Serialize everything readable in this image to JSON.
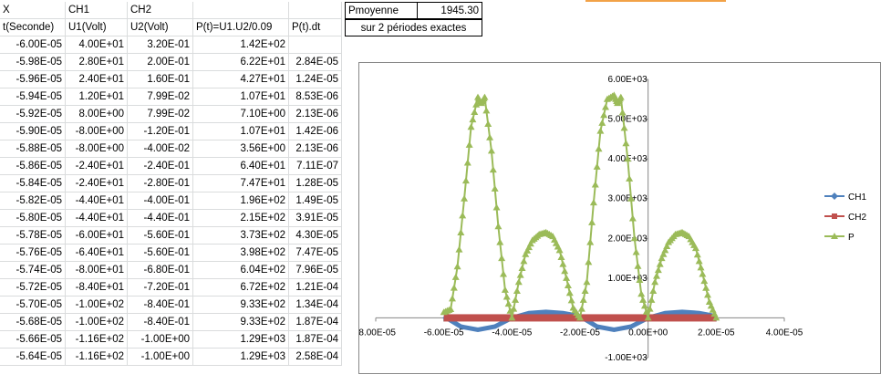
{
  "header": {
    "x": "X",
    "ch1": "CH1",
    "ch2": "CH2"
  },
  "columns": {
    "t": "t(Seconde)",
    "u1": "U1(Volt)",
    "u2": "U2(Volt)",
    "p": "P(t)=U1.U2/0.09",
    "pdt": "P(t).dt"
  },
  "rows": [
    [
      "-6.00E-05",
      "4.00E+01",
      "3.20E-01",
      "1.42E+02",
      ""
    ],
    [
      "-5.98E-05",
      "2.80E+01",
      "2.00E-01",
      "6.22E+01",
      "2.84E-05"
    ],
    [
      "-5.96E-05",
      "2.40E+01",
      "1.60E-01",
      "4.27E+01",
      "1.24E-05"
    ],
    [
      "-5.94E-05",
      "1.20E+01",
      "7.99E-02",
      "1.07E+01",
      "8.53E-06"
    ],
    [
      "-5.92E-05",
      "8.00E+00",
      "7.99E-02",
      "7.10E+00",
      "2.13E-06"
    ],
    [
      "-5.90E-05",
      "-8.00E+00",
      "-1.20E-01",
      "1.07E+01",
      "1.42E-06"
    ],
    [
      "-5.88E-05",
      "-8.00E+00",
      "-4.00E-02",
      "3.56E+00",
      "2.13E-06"
    ],
    [
      "-5.86E-05",
      "-2.40E+01",
      "-2.40E-01",
      "6.40E+01",
      "7.11E-07"
    ],
    [
      "-5.84E-05",
      "-2.40E+01",
      "-2.80E-01",
      "7.47E+01",
      "1.28E-05"
    ],
    [
      "-5.82E-05",
      "-4.40E+01",
      "-4.00E-01",
      "1.96E+02",
      "1.49E-05"
    ],
    [
      "-5.80E-05",
      "-4.40E+01",
      "-4.40E-01",
      "2.15E+02",
      "3.91E-05"
    ],
    [
      "-5.78E-05",
      "-6.00E+01",
      "-5.60E-01",
      "3.73E+02",
      "4.30E-05"
    ],
    [
      "-5.76E-05",
      "-6.40E+01",
      "-5.60E-01",
      "3.98E+02",
      "7.47E-05"
    ],
    [
      "-5.74E-05",
      "-8.00E+01",
      "-6.80E-01",
      "6.04E+02",
      "7.96E-05"
    ],
    [
      "-5.72E-05",
      "-8.40E+01",
      "-7.20E-01",
      "6.72E+02",
      "1.21E-04"
    ],
    [
      "-5.70E-05",
      "-1.00E+02",
      "-8.40E-01",
      "9.33E+02",
      "1.34E-04"
    ],
    [
      "-5.68E-05",
      "-1.00E+02",
      "-8.40E-01",
      "9.33E+02",
      "1.87E-04"
    ],
    [
      "-5.66E-05",
      "-1.16E+02",
      "-1.00E+00",
      "1.29E+03",
      "1.87E-04"
    ],
    [
      "-5.64E-05",
      "-1.16E+02",
      "-1.00E+00",
      "1.29E+03",
      "2.58E-04"
    ]
  ],
  "summary": {
    "label": "Pmoyenne",
    "value": "1945.30",
    "note": "sur 2 périodes exactes"
  },
  "chart_data": {
    "type": "line",
    "title": "",
    "xlim": [
      -8e-05,
      4e-05
    ],
    "ylim": [
      -1000,
      6000
    ],
    "x_ticks": [
      "-8.00E-05",
      "-6.00E-05",
      "-4.00E-05",
      "-2.00E-05",
      "0.00E+00",
      "2.00E-05",
      "4.00E-05"
    ],
    "y_ticks": [
      "-1.00E+03",
      "0.00E+00",
      "1.00E+03",
      "2.00E+03",
      "3.00E+03",
      "4.00E+03",
      "5.00E+03",
      "6.00E+03"
    ],
    "legend_position": "right",
    "series": [
      {
        "name": "CH1",
        "color": "#4f81bd",
        "marker": "diamond",
        "description": "sinusoid, range about -300 to 150, period 4.00E-05",
        "x": [
          -6e-05,
          -5.5e-05,
          -5e-05,
          -4.5e-05,
          -4e-05,
          -3.5e-05,
          -3e-05,
          -2.5e-05,
          -2e-05,
          -1.5e-05,
          -1e-05,
          -5e-06,
          0.0,
          5e-06,
          1e-05,
          1.5e-05,
          2e-05
        ],
        "y": [
          40,
          -220,
          -300,
          -220,
          0,
          120,
          150,
          120,
          40,
          -220,
          -300,
          -220,
          0,
          120,
          150,
          120,
          40
        ]
      },
      {
        "name": "CH2",
        "color": "#c0504d",
        "marker": "square",
        "description": "near zero",
        "x": [
          -6e-05,
          2e-05
        ],
        "y": [
          0,
          0
        ]
      },
      {
        "name": "P",
        "color": "#9bbb59",
        "marker": "triangle",
        "x": [
          -6e-05,
          -5.8e-05,
          -5.6e-05,
          -5.4e-05,
          -5.2e-05,
          -5e-05,
          -4.9e-05,
          -4.8e-05,
          -4.6e-05,
          -4.4e-05,
          -4.2e-05,
          -4e-05,
          -3.8e-05,
          -3.6e-05,
          -3.4e-05,
          -3.2e-05,
          -3e-05,
          -2.8e-05,
          -2.6e-05,
          -2.4e-05,
          -2.2e-05,
          -2e-05,
          -1.8e-05,
          -1.6e-05,
          -1.4e-05,
          -1.2e-05,
          -1e-05,
          -9e-06,
          -8e-06,
          -6e-06,
          -4e-06,
          -2e-06,
          0.0,
          2e-06,
          4e-06,
          6e-06,
          8e-06,
          1e-05,
          1.2e-05,
          1.4e-05,
          1.6e-05,
          1.8e-05,
          2e-05
        ],
        "y": [
          142,
          215,
          1290,
          3000,
          4800,
          5550,
          5400,
          5550,
          4200,
          2300,
          700,
          0,
          900,
          1600,
          1950,
          2100,
          2150,
          2050,
          1700,
          1000,
          250,
          0,
          900,
          2900,
          4700,
          5500,
          5600,
          5400,
          5550,
          4000,
          2000,
          600,
          0,
          900,
          1500,
          1900,
          2100,
          2150,
          2050,
          1750,
          1100,
          400,
          0
        ]
      }
    ]
  }
}
